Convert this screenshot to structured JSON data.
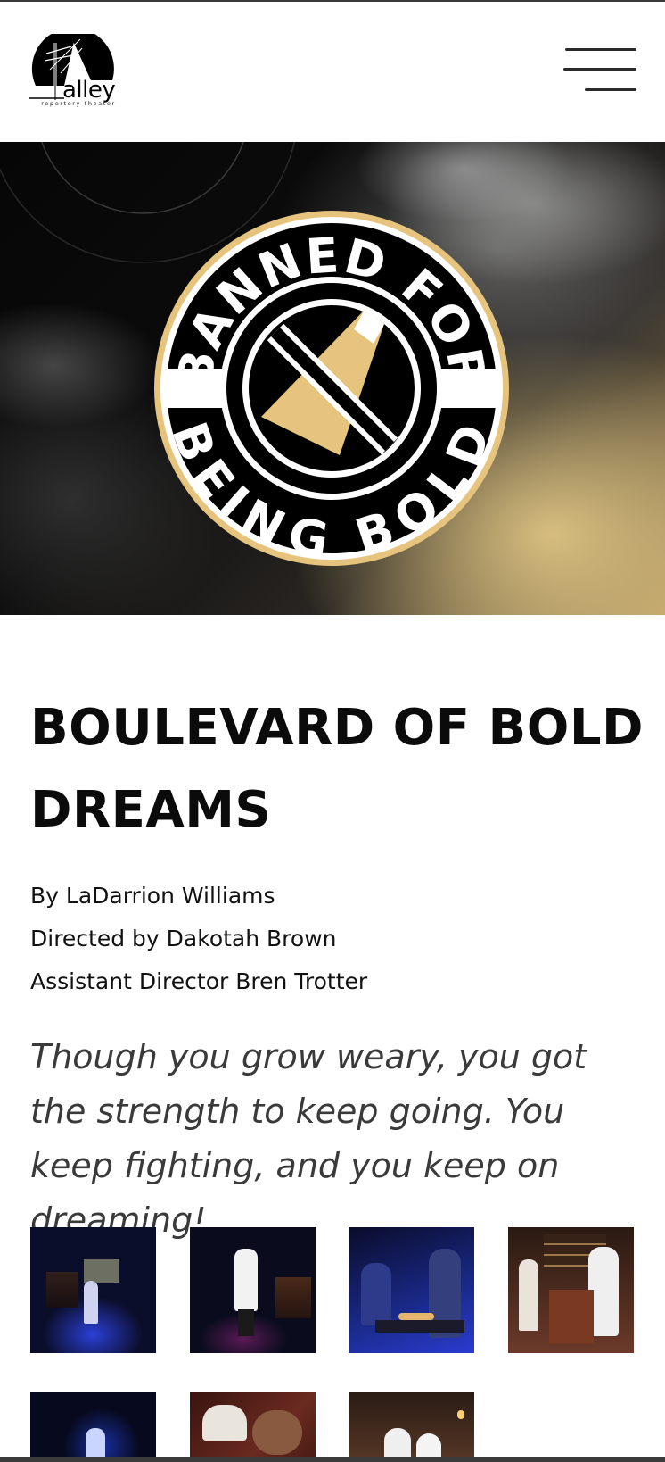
{
  "header": {
    "logo_word": "alley",
    "logo_tagline": "repertory theater",
    "menu_label": "Menu"
  },
  "hero": {
    "badge_top_text": "BANNED FOR",
    "badge_bottom_text": "BEING BOLD",
    "badge_icon": "banned-pencil-icon",
    "gold_color": "#E7C47E"
  },
  "show": {
    "title": "BOULEVARD OF BOLD DREAMS",
    "playwright": "By LaDarrion Williams",
    "director": "Directed by Dakotah Brown",
    "assistant_director": "Assistant Director Bren Trotter",
    "quote": "Though you grow weary, you got the strength to keep going. You keep fighting, and you keep on dreaming!"
  },
  "gallery": {
    "photo_count": 7
  },
  "colors": {
    "text": "#111111",
    "quote": "#3a3a3a",
    "badge_gold": "#E7C47E"
  }
}
